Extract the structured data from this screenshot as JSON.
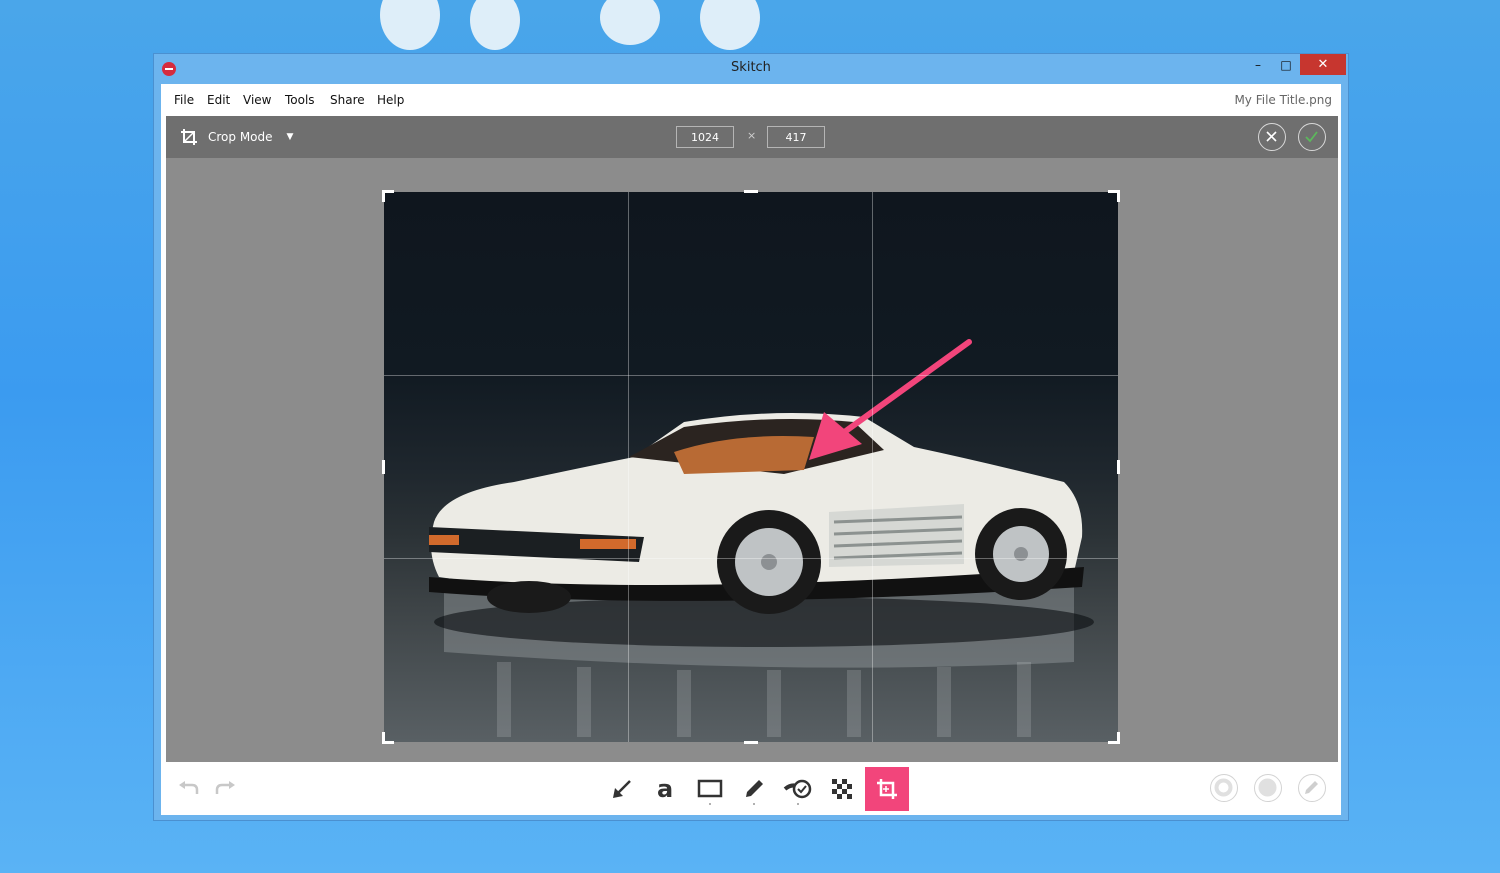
{
  "window": {
    "title": "Skitch"
  },
  "window_controls": {
    "minimize": "–",
    "maximize": "□",
    "close": "✕"
  },
  "menubar": {
    "items": [
      "File",
      "Edit",
      "View",
      "Tools",
      "Share",
      "Help"
    ],
    "file_title": "My File Title.png"
  },
  "cropbar": {
    "mode_label": "Crop Mode",
    "width_value": "1024",
    "height_value": "417",
    "times_symbol": "×"
  },
  "colors": {
    "accent": "#f2457b",
    "crop_toolbar": "#6f6f6f",
    "canvas": "#8c8c8c",
    "confirm": "#5cb85c",
    "close_button": "#c7362f"
  },
  "icons": {
    "crop_mode": "crop-icon",
    "cancel": "close-circle-icon",
    "confirm": "checkmark-circle-icon",
    "undo": "undo-icon",
    "redo": "redo-icon",
    "tools": [
      "arrow-icon",
      "text-icon",
      "rectangle-icon",
      "marker-icon",
      "stamp-icon",
      "pixelate-icon",
      "crop-icon"
    ],
    "right": [
      "color-ring-icon",
      "color-fill-icon",
      "pencil-icon"
    ]
  }
}
